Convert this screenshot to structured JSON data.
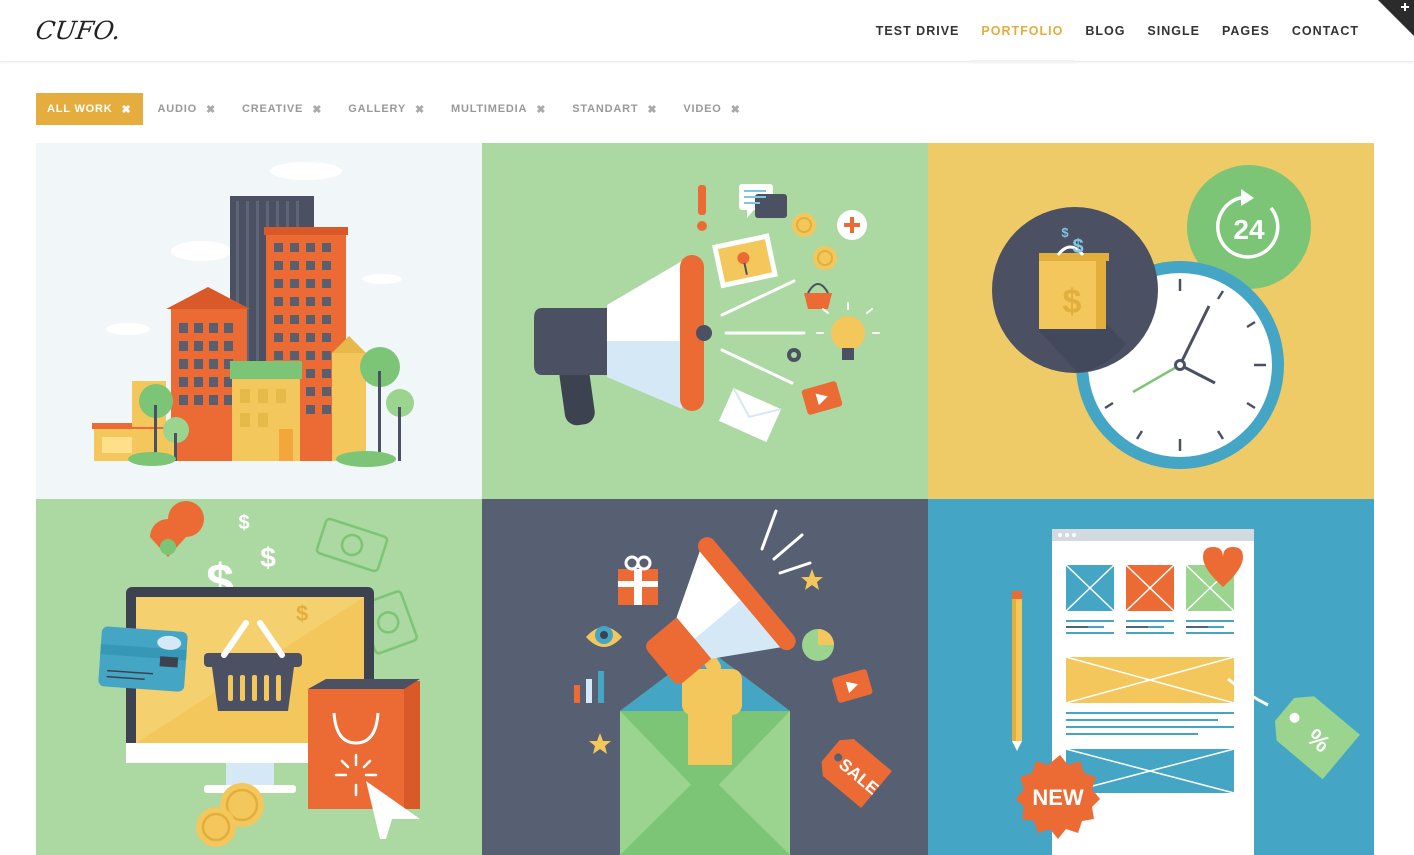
{
  "site": {
    "logo": "CUFO."
  },
  "nav": {
    "items": [
      {
        "label": "TEST DRIVE",
        "active": false
      },
      {
        "label": "PORTFOLIO",
        "active": true
      },
      {
        "label": "BLOG",
        "active": false
      },
      {
        "label": "SINGLE",
        "active": false
      },
      {
        "label": "PAGES",
        "active": false
      },
      {
        "label": "CONTACT",
        "active": false
      }
    ],
    "corner_icon": "plus-icon"
  },
  "filters": {
    "items": [
      {
        "label": "ALL WORK",
        "active": true
      },
      {
        "label": "AUDIO",
        "active": false
      },
      {
        "label": "CREATIVE",
        "active": false
      },
      {
        "label": "GALLERY",
        "active": false
      },
      {
        "label": "MULTIMEDIA",
        "active": false
      },
      {
        "label": "STANDART",
        "active": false
      },
      {
        "label": "VIDEO",
        "active": false
      }
    ],
    "remove_glyph": "✖"
  },
  "colors": {
    "accent": "#e5ac3e",
    "tile_city": "#f1f7f8",
    "tile_megaphone": "#acd8a2",
    "tile_clock": "#eecb66",
    "tile_shop": "#acd8a2",
    "tile_promo": "#575f72",
    "tile_web": "#44a5c4"
  },
  "tiles": {
    "clock_badge": "24",
    "new_badge": "NEW",
    "sale_tag": "SALE",
    "percent_tag": "%",
    "dollar": "$"
  }
}
